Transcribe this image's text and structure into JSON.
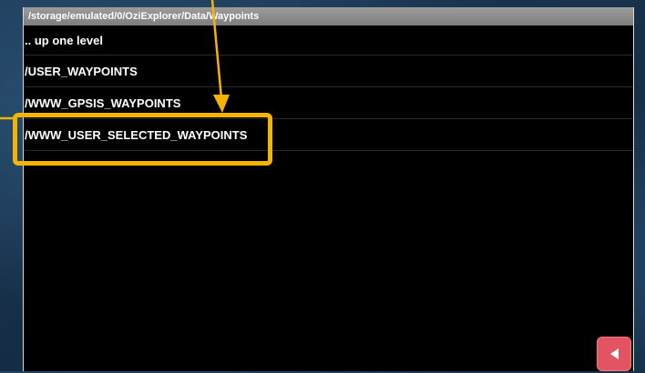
{
  "header": {
    "path": "/storage/emulated/0/OziExplorer/Data/Waypoints"
  },
  "list": {
    "items": [
      ".. up one level",
      "/USER_WAYPOINTS",
      "/WWW_GPSIS_WAYPOINTS",
      "/WWW_USER_SELECTED_WAYPOINTS"
    ]
  },
  "annotation": {
    "highlight_color": "#f5b400"
  },
  "back_button": {
    "color": "#e35462",
    "icon": "back-triangle-icon"
  }
}
